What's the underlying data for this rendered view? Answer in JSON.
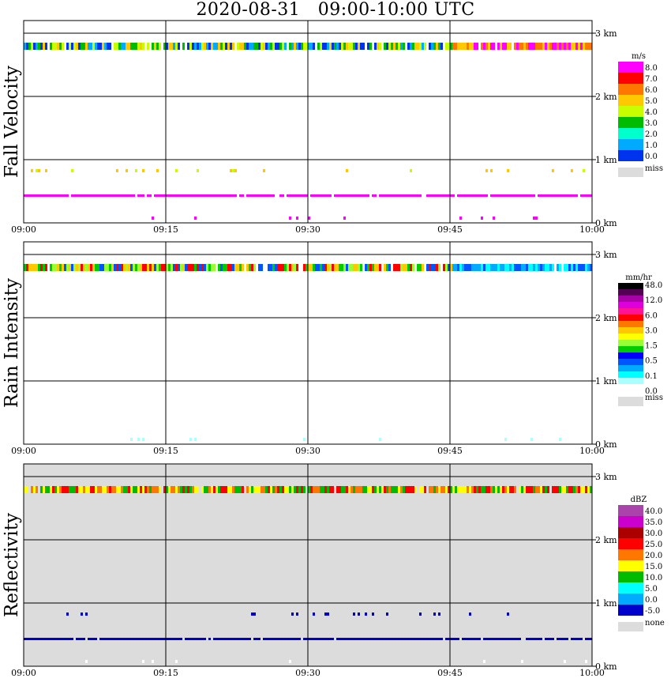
{
  "title": "2020-08-31   09:00-10:00 UTC",
  "chart_data": [
    {
      "type": "heatmap",
      "ylabel": "Fall Velocity",
      "x_tick_labels": [
        "09:00",
        "09:15",
        "09:30",
        "09:45",
        "10:00"
      ],
      "y_tick_labels": [
        "0 km",
        "1 km",
        "2 km",
        "3 km"
      ],
      "ylim_km": [
        0,
        3.2
      ],
      "colorbar": {
        "unit": "m/s",
        "labels": [
          "8.0",
          "7.0",
          "6.0",
          "5.0",
          "4.0",
          "3.0",
          "2.0",
          "1.0",
          "0.0"
        ],
        "colors": [
          "#ff00ff",
          "#ff0000",
          "#ff7700",
          "#ffc800",
          "#c8ff00",
          "#00bb00",
          "#00ffcc",
          "#00aaff",
          "#0033ee"
        ],
        "missing_label": "miss",
        "missing_color": "#dcdcdc"
      },
      "features": [
        {
          "height_km": 2.8,
          "extent": "full hour",
          "colors": "green/blue/yellow mix, orange-magenta after 09:45"
        },
        {
          "height_km": 0.8,
          "extent": "intermittent",
          "colors": "yellow-green"
        },
        {
          "height_km": 0.4,
          "extent": "full hour",
          "colors": "magenta"
        },
        {
          "height_km": 0.05,
          "extent": "sparse",
          "colors": "magenta"
        }
      ]
    },
    {
      "type": "heatmap",
      "ylabel": "Rain Intensity",
      "x_tick_labels": [
        "09:00",
        "09:15",
        "09:30",
        "09:45",
        "10:00"
      ],
      "y_tick_labels": [
        "0 km",
        "1 km",
        "2 km",
        "3 km"
      ],
      "ylim_km": [
        0,
        3.2
      ],
      "colorbar": {
        "unit": "mm/hr",
        "labels": [
          "48.0",
          "12.0",
          "6.0",
          "3.0",
          "1.5",
          "0.5",
          "0.1",
          "0.0"
        ],
        "colors": [
          "#000000",
          "#550055",
          "#aa00aa",
          "#dd00dd",
          "#ff1493",
          "#ff0000",
          "#ff7700",
          "#ffc800",
          "#ffff00",
          "#99ff33",
          "#00cc00",
          "#0000ff",
          "#0055ff",
          "#00aaff",
          "#00ffff",
          "#aaffff",
          "#ffffff"
        ],
        "missing_label": "miss",
        "missing_color": "#dcdcdc"
      },
      "features": [
        {
          "height_km": 2.8,
          "extent": "full hour",
          "colors": "red/green/yellow mix, blue-cyan after 09:45"
        },
        {
          "height_km": 0.05,
          "extent": "sparse",
          "colors": "cyan"
        }
      ]
    },
    {
      "type": "heatmap",
      "ylabel": "Reflectivity",
      "x_tick_labels": [
        "09:00",
        "09:15",
        "09:30",
        "09:45",
        "10:00"
      ],
      "y_tick_labels": [
        "0 km",
        "1 km",
        "2 km",
        "3 km"
      ],
      "ylim_km": [
        0,
        3.2
      ],
      "background": "#dcdcdc",
      "colorbar": {
        "unit": "dBZ",
        "labels": [
          "40.0",
          "35.0",
          "30.0",
          "25.0",
          "20.0",
          "15.0",
          "10.0",
          "5.0",
          "0.0",
          "-5.0"
        ],
        "colors": [
          "#aa44aa",
          "#cc00cc",
          "#aa0000",
          "#ff0000",
          "#ff7700",
          "#ffff00",
          "#00bb00",
          "#00ffff",
          "#00aaff",
          "#0000cc"
        ],
        "missing_label": "none",
        "missing_color": "#dcdcdc"
      },
      "features": [
        {
          "height_km": 2.8,
          "extent": "full hour",
          "colors": "orange/red with green-yellow mix"
        },
        {
          "height_km": 0.8,
          "extent": "intermittent",
          "colors": "dark blue"
        },
        {
          "height_km": 0.4,
          "extent": "full hour",
          "colors": "dark blue"
        },
        {
          "height_km": 0.05,
          "extent": "sparse",
          "colors": "white"
        }
      ]
    }
  ]
}
